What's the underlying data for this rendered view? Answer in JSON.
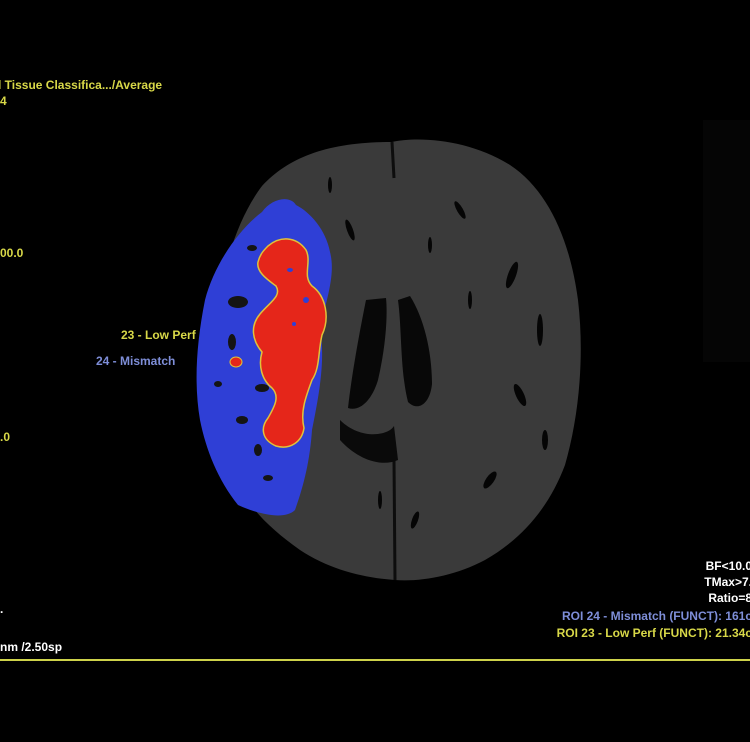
{
  "overlay": {
    "series_title": "l Tissue Classifica.../Average",
    "series_sub": "4",
    "scale_top": "00.0",
    "scale_bottom": ".0",
    "slice_info": "nm /2.50sp",
    "left_dot": "."
  },
  "roi_labels": {
    "roi23": "23 - Low Perf",
    "roi24": "24 - Mismatch"
  },
  "thresholds": {
    "bf": "BF<10.0",
    "tmax": "TMax>7.",
    "ratio": "Ratio=8"
  },
  "roi_stats": {
    "roi24": "ROI 24 - Mismatch (FUNCT): 161c",
    "roi23": "ROI 23 - Low Perf (FUNCT): 21.34c"
  },
  "colors": {
    "background": "#000000",
    "brain_tissue": "#3a3a3a",
    "mismatch_blue": "#2f3fd6",
    "low_perf_red": "#e5261a",
    "contour_yellow": "#e0c23a",
    "annotation_yellow": "#d8d848",
    "annotation_blue": "#7e8ed8"
  },
  "icons": {
    "brain": "axial-brain-ct-perfusion-map"
  }
}
